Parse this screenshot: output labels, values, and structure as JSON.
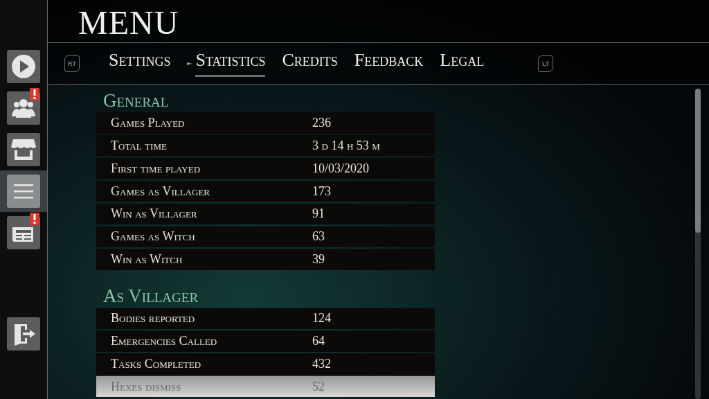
{
  "title": "MENU",
  "sidebar": {
    "items": [
      {
        "kind": "play",
        "selected": false,
        "alert": false
      },
      {
        "kind": "friends",
        "selected": false,
        "alert": true
      },
      {
        "kind": "shop",
        "selected": false,
        "alert": false
      },
      {
        "kind": "menu",
        "selected": true,
        "alert": false
      },
      {
        "kind": "news",
        "selected": false,
        "alert": true
      }
    ],
    "exit": {
      "kind": "exit"
    }
  },
  "tabs": {
    "left_key": "RT",
    "right_key": "LT",
    "items": [
      {
        "label": "Settings",
        "selected": false
      },
      {
        "label": "Statistics",
        "selected": true
      },
      {
        "label": "Credits",
        "selected": false
      },
      {
        "label": "Feedback",
        "selected": false
      },
      {
        "label": "Legal",
        "selected": false
      }
    ]
  },
  "sections": [
    {
      "title": "General",
      "rows": [
        {
          "label": "Games Played",
          "value": "236"
        },
        {
          "label": "Total time",
          "value": "3 d 14 h 53 m"
        },
        {
          "label": "First time played",
          "value": "10/03/2020"
        },
        {
          "label": "Games as Villager",
          "value": "173"
        },
        {
          "label": "Win as Villager",
          "value": "91"
        },
        {
          "label": "Games as Witch",
          "value": "63"
        },
        {
          "label": "Win as Witch",
          "value": "39"
        }
      ]
    },
    {
      "title": "As Villager",
      "rows": [
        {
          "label": "Bodies reported",
          "value": "124"
        },
        {
          "label": "Emergencies Called",
          "value": "64"
        },
        {
          "label": "Tasks Completed",
          "value": "432"
        },
        {
          "label": "Hexes dismiss",
          "value": "52"
        }
      ]
    }
  ]
}
